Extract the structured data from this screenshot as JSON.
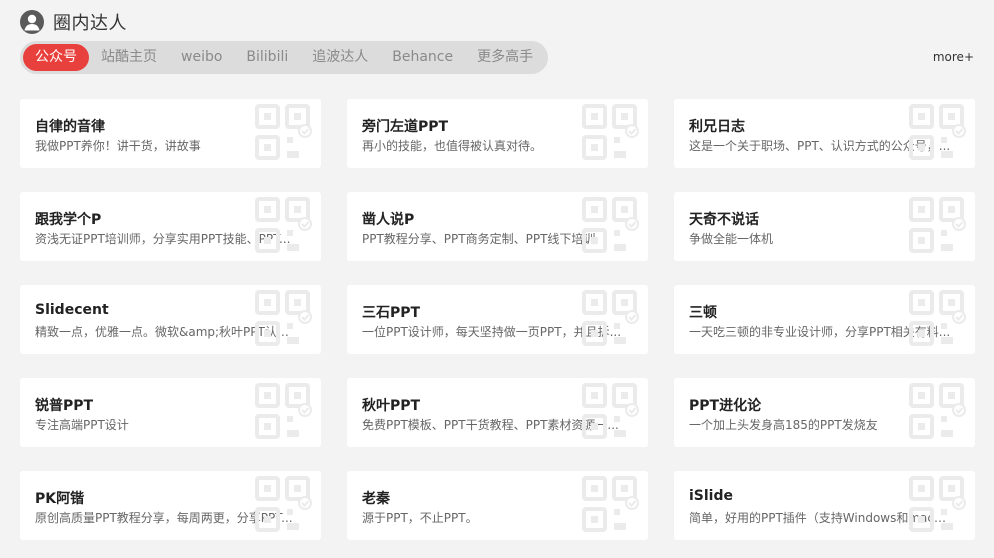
{
  "header": {
    "title": "圈内达人",
    "icon": "user-icon"
  },
  "tabs": [
    {
      "label": "公众号",
      "active": true
    },
    {
      "label": "站酷主页",
      "active": false
    },
    {
      "label": "weibo",
      "active": false
    },
    {
      "label": "Bilibili",
      "active": false
    },
    {
      "label": "追波达人",
      "active": false
    },
    {
      "label": "Behance",
      "active": false
    },
    {
      "label": "更多高手",
      "active": false
    }
  ],
  "more_label": "more+",
  "colors": {
    "accent": "#e8413d",
    "background": "#f3f3f3",
    "tab_bar": "#dcdcdc",
    "qr_icon": "#ebebeb"
  },
  "cards": [
    {
      "name": "自律的音律",
      "desc": "我做PPT养你！讲干货，讲故事"
    },
    {
      "name": "旁门左道PPT",
      "desc": "再小的技能，也值得被认真对待。"
    },
    {
      "name": "利兄日志",
      "desc": "这是一个关于职场、PPT、认识方式的公众号，..."
    },
    {
      "name": "跟我学个P",
      "desc": "资浅无证PPT培训师，分享实用PPT技能、PPT..."
    },
    {
      "name": "凿人说P",
      "desc": "PPT教程分享、PPT商务定制、PPT线下培训"
    },
    {
      "name": "天奇不说话",
      "desc": "争做全能一体机"
    },
    {
      "name": "Slidecent",
      "desc": "精致一点，优雅一点。微软&amp;秋叶PPT认证..."
    },
    {
      "name": "三石PPT",
      "desc": "一位PPT设计师，每天坚持做一页PPT，并且拆..."
    },
    {
      "name": "三顿",
      "desc": "一天吃三顿的非专业设计师，分享PPT相关有料..."
    },
    {
      "name": "锐普PPT",
      "desc": "专注高端PPT设计"
    },
    {
      "name": "秋叶PPT",
      "desc": "免费PPT模板、PPT干货教程、PPT素材资源一..."
    },
    {
      "name": "PPT进化论",
      "desc": "一个加上头发身高185的PPT发烧友"
    },
    {
      "name": "PK阿锴",
      "desc": "原创高质量PPT教程分享，每周两更，分享PPT..."
    },
    {
      "name": "老秦",
      "desc": "源于PPT，不止PPT。"
    },
    {
      "name": "iSlide",
      "desc": "简单，好用的PPT插件（支持Windows和macO..."
    }
  ]
}
